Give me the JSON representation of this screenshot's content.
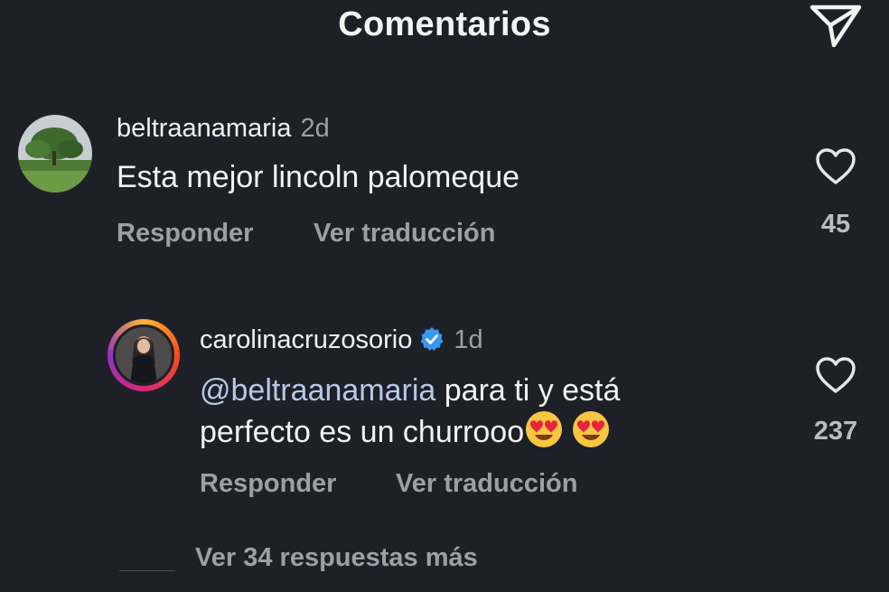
{
  "header": {
    "title": "Comentarios"
  },
  "comments": [
    {
      "username": "beltraanamaria",
      "time": "2d",
      "text": "Esta mejor lincoln palomeque",
      "reply_label": "Responder",
      "translate_label": "Ver traducción",
      "likes": "45"
    },
    {
      "username": "carolinacruzosorio",
      "time": "1d",
      "mention": "@beltraanamaria",
      "text_line1": " para ti y está",
      "text_line2": "perfecto es un churrooo",
      "reply_label": "Responder",
      "translate_label": "Ver traducción",
      "likes": "237"
    }
  ],
  "more_replies": "Ver 34 respuestas más",
  "icons": {
    "send": "paper-plane-icon",
    "like": "heart-icon",
    "verified": "verified-badge-icon",
    "emoji": "heart-eyes-emoji"
  },
  "colors": {
    "background": "#1d2027",
    "mention": "#b8c7e8",
    "verified": "#3897f0"
  }
}
